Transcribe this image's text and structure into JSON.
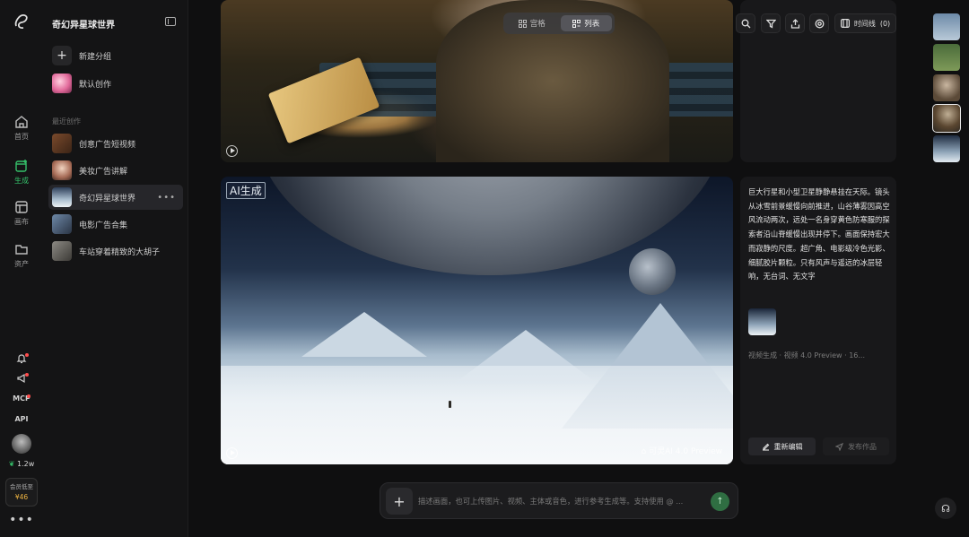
{
  "nav": {
    "items": [
      {
        "label": "首页",
        "icon": "home-icon"
      },
      {
        "label": "生成",
        "icon": "generate-icon",
        "active": true
      },
      {
        "label": "画布",
        "icon": "canvas-icon"
      },
      {
        "label": "资产",
        "icon": "folder-icon"
      }
    ],
    "utils": {
      "mcp": "MCP",
      "api": "API"
    },
    "credits": "1.2w",
    "member": {
      "label": "会员低至",
      "price": "¥46"
    }
  },
  "sidebar": {
    "title": "奇幻异星球世界",
    "new_group": "新建分组",
    "default_item": "默认创作",
    "section_label": "最近创作",
    "items": [
      {
        "label": "创意广告短视频"
      },
      {
        "label": "美妆广告讲解"
      },
      {
        "label": "奇幻异星球世界",
        "active": true
      },
      {
        "label": "电影广告合集"
      },
      {
        "label": "车站穿着精致的大胡子"
      }
    ]
  },
  "view_toggle": {
    "grid": "宫格",
    "list": "列表",
    "active": "list"
  },
  "toolbar": {
    "timeline": "时间线",
    "timeline_count": "(0)"
  },
  "card2": {
    "description": "巨大行星和小型卫星静静悬挂在天际。镜头从冰雪前景缓慢向前推进，山谷薄雾因高空风流动两次，远处一名身穿黄色防寒服的探索者沿山脊缓慢出现并停下。画面保持宏大而寂静的尺度。超广角、电影级冷色光影、细腻胶片颗粒。只有风声与遥远的冰层轻响，无台词、无文字",
    "meta": "视频生成 · 视频 4.0 Preview · 16...",
    "reedit": "重新编辑",
    "publish": "发布作品",
    "ai_tag": "AI生成",
    "watermark": "⌂ 可灵AI 4.0 Preview"
  },
  "prompt": {
    "placeholder": "描述画面，也可上传图片、视频、主体或音色，进行参考生成等。支持使用 @ ..."
  },
  "colors": {
    "accent": "#35c06a",
    "background": "#0f0f10",
    "panel": "#18181a"
  }
}
